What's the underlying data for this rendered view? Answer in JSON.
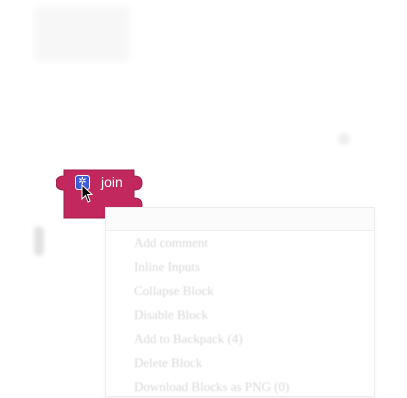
{
  "block": {
    "label": "join",
    "color": "#c2275e",
    "icon": "gear-icon"
  },
  "context_menu": {
    "items": [
      {
        "label": "Add comment"
      },
      {
        "label": "Inline Inputs"
      },
      {
        "label": "Collapse Block"
      },
      {
        "label": "Disable Block"
      },
      {
        "label": "Add to Backpack (4)"
      },
      {
        "label": "Delete Block"
      },
      {
        "label": "Download Blocks as PNG (0)"
      }
    ]
  }
}
